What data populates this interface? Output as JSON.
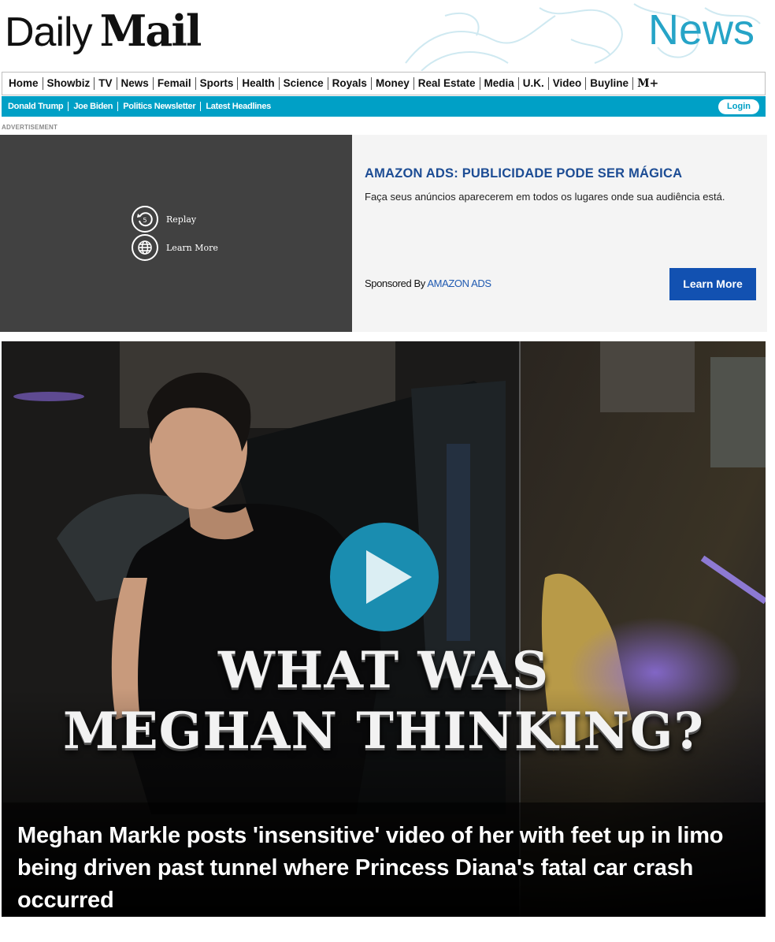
{
  "masthead": {
    "logo_daily": "Daily",
    "logo_mail": "Mail",
    "channel": "News"
  },
  "nav": {
    "items": [
      "Home",
      "Showbiz",
      "TV",
      "News",
      "Femail",
      "Sports",
      "Health",
      "Science",
      "Royals",
      "Money",
      "Real Estate",
      "Media",
      "U.K.",
      "Video",
      "Buyline",
      "M+"
    ]
  },
  "subnav": {
    "items": [
      "Donald Trump",
      "Joe Biden",
      "Politics Newsletter",
      "Latest Headlines"
    ],
    "login": "Login"
  },
  "ad": {
    "label": "ADVERTISEMENT",
    "replay": "Replay",
    "learn_more_small": "Learn More",
    "title": "AMAZON ADS: PUBLICIDADE PODE SER MÁGICA",
    "body": "Faça seus anúncios aparecerem em todos os lugares onde sua audiência está.",
    "sponsored_by": "Sponsored By",
    "sponsor": "AMAZON ADS",
    "button": "Learn More"
  },
  "hero": {
    "overlay_line1": "WHAT WAS",
    "overlay_line2": "MEGHAN THINKING?",
    "headline": "Meghan Markle posts 'insensitive' video of her with feet up in limo being driven past tunnel where Princess Diana's fatal car crash occurred"
  },
  "colors": {
    "brand_blue": "#00a0c6",
    "channel_blue": "#26a4c7",
    "ad_title": "#1c4c94",
    "ad_button": "#1251b1",
    "play_button": "#1a8db0"
  },
  "icons": {
    "replay": "replay-icon",
    "globe": "globe-icon",
    "play": "play-icon"
  }
}
